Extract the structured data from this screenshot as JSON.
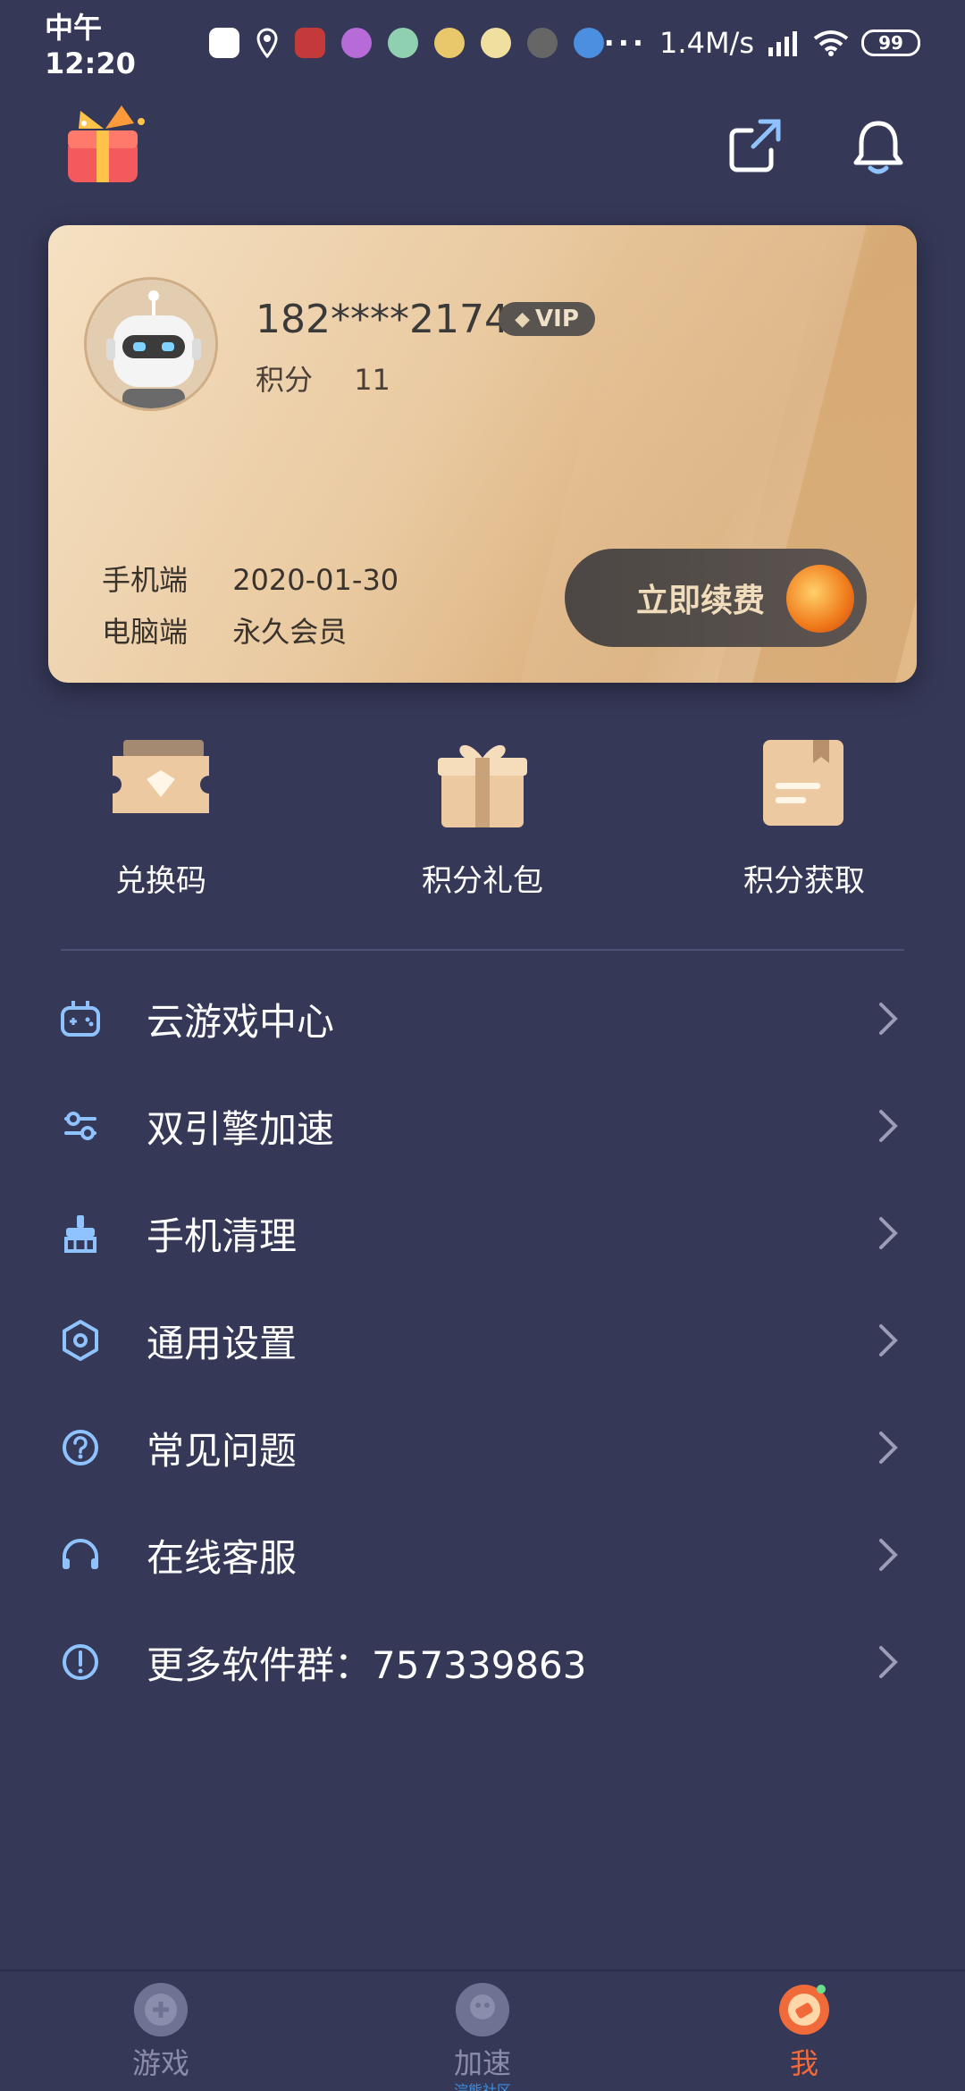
{
  "status_bar": {
    "time": "中午12:20",
    "network_speed": "1.4M/s",
    "battery": "99"
  },
  "card": {
    "phone": "182****2174",
    "vip_label": "VIP",
    "points_label": "积分",
    "points_value": "11",
    "mobile_label": "手机端",
    "mobile_expiry": "2020-01-30",
    "pc_label": "电脑端",
    "pc_status": "永久会员",
    "renew_button": "立即续费"
  },
  "quick_actions": [
    {
      "label": "兑换码",
      "icon": "ticket-icon"
    },
    {
      "label": "积分礼包",
      "icon": "gift-icon"
    },
    {
      "label": "积分获取",
      "icon": "note-icon"
    }
  ],
  "menu": [
    {
      "label": "云游戏中心",
      "icon": "gamepad-icon"
    },
    {
      "label": "双引擎加速",
      "icon": "sliders-icon"
    },
    {
      "label": "手机清理",
      "icon": "broom-icon"
    },
    {
      "label": "通用设置",
      "icon": "settings-icon"
    },
    {
      "label": "常见问题",
      "icon": "question-icon"
    },
    {
      "label": "在线客服",
      "icon": "headset-icon"
    },
    {
      "label": "更多软件群：757339863",
      "icon": "info-icon"
    }
  ],
  "nav": [
    {
      "label": "游戏",
      "active": false
    },
    {
      "label": "加速",
      "sublabel": "浣熊社区",
      "active": false
    },
    {
      "label": "我",
      "active": true
    }
  ],
  "colors": {
    "background": "#353857",
    "accent": "#f06a3a",
    "icon_blue": "#8fc3ff",
    "card_gold": "#e9c9a0"
  }
}
